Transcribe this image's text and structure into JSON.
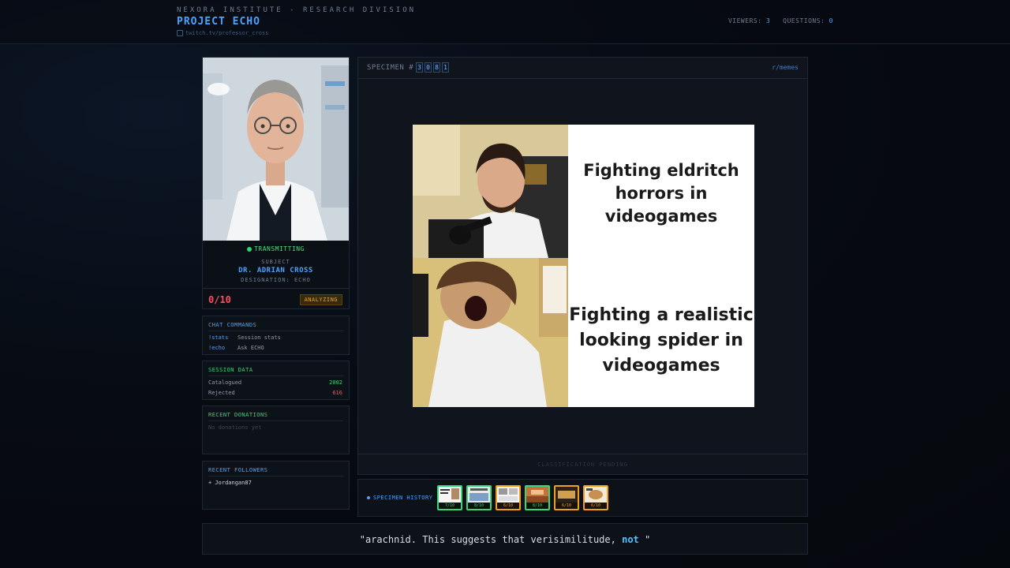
{
  "header": {
    "org": "NEXORA INSTITUTE - RESEARCH DIVISION",
    "project": "PROJECT ECHO",
    "channel": "twitch.tv/professor_cross",
    "viewers_label": "VIEWERS:",
    "viewers": "3",
    "questions_label": "QUESTIONS:",
    "questions": "0"
  },
  "subject": {
    "status": "TRANSMITTING",
    "label": "SUBJECT",
    "name": "DR. ADRIAN CROSS",
    "designation": "DESIGNATION: ECHO",
    "score": "0/10",
    "state": "ANALYZING"
  },
  "commands": {
    "title": "CHAT COMMANDS",
    "items": [
      {
        "key": "!stats",
        "desc": "Session stats"
      },
      {
        "key": "!echo",
        "desc": "Ask ECHO"
      }
    ]
  },
  "session": {
    "title": "SESSION DATA",
    "catalogued_label": "Catalogued",
    "catalogued": "2002",
    "rejected_label": "Rejected",
    "rejected": "616"
  },
  "donations": {
    "title": "RECENT DONATIONS",
    "empty": "No donations yet"
  },
  "followers": {
    "title": "RECENT FOLLOWERS",
    "items": [
      "+ Jordangan87"
    ]
  },
  "specimen": {
    "label": "SPECIMEN #",
    "digits": [
      "3",
      "0",
      "8",
      "1"
    ],
    "source": "r/memes",
    "meme_top": "Fighting eldritch horrors in videogames",
    "meme_bottom": "Fighting a realistic looking spider in videogames",
    "classification": "CLASSIFICATION PENDING"
  },
  "history": {
    "label": "SPECIMEN HISTORY",
    "items": [
      {
        "score": "7/10",
        "tier": "green"
      },
      {
        "score": "8/10",
        "tier": "green"
      },
      {
        "score": "6/10",
        "tier": "orange"
      },
      {
        "score": "8/10",
        "tier": "green"
      },
      {
        "score": "6/10",
        "tier": "orange"
      },
      {
        "score": "6/10",
        "tier": "orange"
      }
    ]
  },
  "quote": {
    "before": "\"arachnid. This suggests that verisimilitude, ",
    "highlight": "not",
    "after": " \""
  },
  "colors": {
    "accent": "#4aa3ff",
    "success": "#3ed47a",
    "warning": "#f0a020",
    "danger": "#ff4d5e"
  }
}
